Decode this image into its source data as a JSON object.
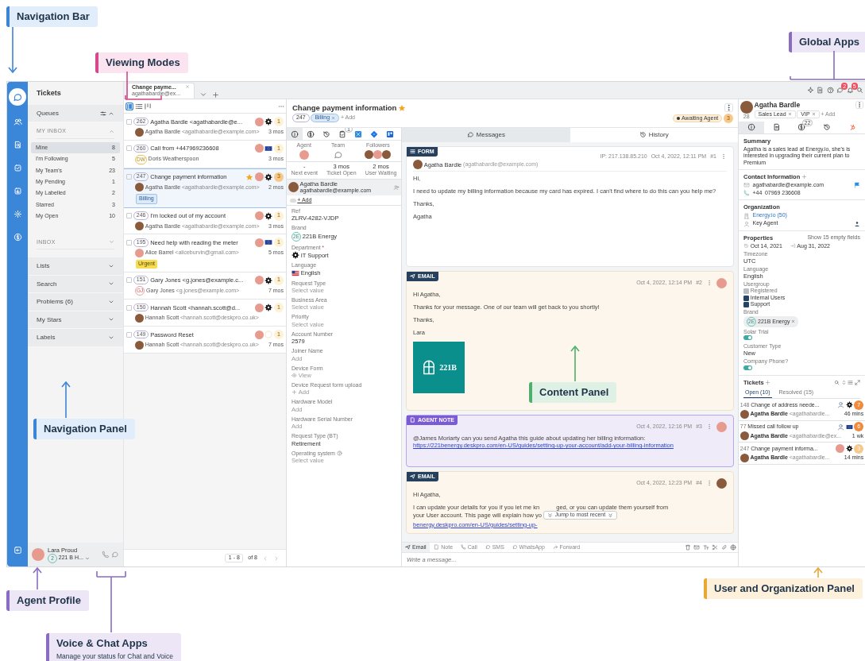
{
  "annotations": [
    {
      "title": "Navigation Bar",
      "color": "#3b84d8"
    },
    {
      "title": "Viewing Modes",
      "color": "#d6478c"
    },
    {
      "title": "Global Apps",
      "color": "#8a6cc2"
    },
    {
      "title": "Navigation Panel",
      "color": "#3b84d8"
    },
    {
      "title": "Content Panel",
      "color": "#4caf6a"
    },
    {
      "title": "Agent Profile",
      "color": "#8a6cc2"
    },
    {
      "title": "Voice & Chat Apps",
      "subtitle": "Manage your status for Chat and Voice",
      "color": "#8a6cc2"
    },
    {
      "title": "User and Organization Panel",
      "color": "#e8a835"
    }
  ],
  "rail": {
    "items": [
      {
        "selected": true
      },
      {
        "selected": false
      },
      {
        "selected": false
      },
      {
        "selected": false
      },
      {
        "selected": false
      },
      {
        "selected": false
      },
      {
        "selected": false
      }
    ]
  },
  "nav_panel": {
    "title": "Tickets",
    "queues": {
      "label": "Queues",
      "expanded": true
    },
    "my_inbox": {
      "label": "MY INBOX",
      "expanded": true,
      "items": [
        {
          "label": "Mine",
          "count": "8",
          "selected": true
        },
        {
          "label": "I'm Following",
          "count": "5",
          "selected": false
        },
        {
          "label": "My Team's",
          "count": "23",
          "selected": false
        },
        {
          "label": "My Pending",
          "count": "1",
          "selected": false
        },
        {
          "label": "My Labelled",
          "count": "2",
          "selected": false
        },
        {
          "label": "Starred",
          "count": "3",
          "selected": false
        },
        {
          "label": "My Open",
          "count": "10",
          "selected": false
        }
      ]
    },
    "inbox": {
      "label": "INBOX",
      "expanded": false
    },
    "sections": [
      {
        "label": "Lists",
        "expanded": false
      },
      {
        "label": "Search",
        "expanded": false
      },
      {
        "label": "Problems (6)",
        "expanded": false
      },
      {
        "label": "My Stars",
        "expanded": false
      },
      {
        "label": "Labels",
        "expanded": false
      }
    ],
    "agent": {
      "name": "Lara Proud",
      "badge": "2",
      "status": "221 B H..."
    }
  },
  "tab": {
    "title": "Change payme...",
    "subtitle": "agathabardle@ex..."
  },
  "global_apps": [
    {
      "kind": "sparkle"
    },
    {
      "kind": "doc"
    },
    {
      "kind": "help"
    },
    {
      "kind": "chat",
      "badge": "2"
    },
    {
      "kind": "bell",
      "badge": "5"
    },
    {
      "kind": "search"
    }
  ],
  "ticket_list": {
    "view_modes": [
      {
        "selected": true
      },
      {
        "selected": false
      },
      {
        "selected": false
      }
    ],
    "tickets": [
      {
        "id": "262",
        "subject": "Agatha Bardle <agathabardle@e...",
        "person": "Agatha Bardle",
        "email": "<agathabardle@example.com>",
        "age": "3 mos",
        "count": "1",
        "color": "#fdf1d6",
        "kind": "gear",
        "starred": false,
        "checked": false,
        "selected": false
      },
      {
        "id": "260",
        "subject": "Call from +447969236608",
        "person": "Doris Weatherspoon",
        "initials": "DW",
        "age": "3 mos",
        "count": "1",
        "color": "#fdf1d6",
        "kind": "flag",
        "starred": false,
        "checked": false,
        "selected": false
      },
      {
        "id": "247",
        "subject": "Change payment information",
        "person": "Agatha Bardle",
        "email": "<agathabardle@example.com>",
        "age": "2 mos",
        "count": "3",
        "color": "#f7c88a",
        "kind": "gear",
        "starred": true,
        "checked": false,
        "selected": true,
        "tag": {
          "label": "Billing",
          "kind": "info"
        }
      },
      {
        "id": "246",
        "subject": "I'm locked out of my account",
        "person": "Agatha Bardle",
        "email": "<agathabardle@example.com>",
        "age": "3 mos",
        "count": "1",
        "color": "#fdf1d6",
        "kind": "gear",
        "starred": false,
        "checked": false,
        "selected": false
      },
      {
        "id": "195",
        "subject": "Need help with reading the meter",
        "person": "Alice Barrel",
        "email": "<aliceburvin@gmail.com>",
        "age": "5 mos",
        "count": "1",
        "color": "#fdf1d6",
        "kind": "flag",
        "starred": false,
        "checked": false,
        "selected": false,
        "tag": {
          "label": "Urgent",
          "kind": "warning"
        }
      },
      {
        "id": "151",
        "subject": "Gary Jones <g.jones@example.c...",
        "person": "Gary Jones",
        "initials": "GJ",
        "email": "<g.jones@example.com>",
        "age": "7 mos",
        "count": "1",
        "color": "#fdf1d6",
        "kind": "gear",
        "starred": false,
        "checked": false,
        "selected": false
      },
      {
        "id": "150",
        "subject": "Hannah Scott <hannah.scott@d...",
        "person": "Hannah Scott",
        "email": "<hannah.scott@deskpro.co.uk>",
        "count": "1",
        "color": "#fdf1d6",
        "kind": "gear",
        "starred": false,
        "checked": false,
        "selected": false
      },
      {
        "id": "149",
        "subject": "Password Reset",
        "person": "Hannah Scott",
        "email": "<hannah.scott@deskpro.co.uk>",
        "age": "7 mos",
        "count": "1",
        "color": "#fdf1d6",
        "kind": "faded",
        "starred": false,
        "checked": false,
        "selected": false
      }
    ],
    "pagination": {
      "range": "1 - 8",
      "total": "of 8"
    }
  },
  "ticket": {
    "title": "Change payment information",
    "starred": true,
    "id": "247",
    "tags": [
      "Billing"
    ],
    "add": "+ Add",
    "status": "Awaiting Agent",
    "status_count": "3",
    "tabs": [
      {
        "selected": true
      },
      {
        "selected": false
      },
      {
        "selected": false
      },
      {
        "badge": "1",
        "selected": false
      },
      {
        "selected": false
      },
      {
        "selected": false
      },
      {
        "selected": false
      }
    ],
    "people": [
      {
        "label": "Agent",
        "kind": "agent"
      },
      {
        "label": "Team",
        "kind": "team"
      },
      {
        "label": "Followers",
        "kind": "followers"
      }
    ],
    "stats": [
      {
        "value": "-",
        "label": "Next event"
      },
      {
        "value": "3 mos",
        "label": "Ticket Open"
      },
      {
        "value": "2 mos",
        "label": "User Waiting"
      }
    ],
    "user": {
      "name": "Agatha Bardle",
      "email": "agathabardle@example.com"
    },
    "cc_add": "+ Add",
    "fields": [
      {
        "label": "Ref",
        "value": "ZLRV-4282-VJDP",
        "kind": "text"
      },
      {
        "label": "Brand",
        "value": "221B Energy",
        "kind": "brand",
        "badge": "2E"
      },
      {
        "label": "Department",
        "marker": "*",
        "value": "IT Support",
        "kind": "dept"
      },
      {
        "label": "Language",
        "value": "English",
        "kind": "lang"
      },
      {
        "label": "Request Type",
        "placeholder": "Select value",
        "kind": "empty"
      },
      {
        "label": "Business Area",
        "placeholder": "Select value",
        "kind": "empty"
      },
      {
        "label": "Priority",
        "placeholder": "Select value",
        "kind": "empty"
      },
      {
        "label": "Account Number",
        "value": "2579",
        "kind": "text"
      },
      {
        "label": "Joiner Name",
        "placeholder": "Add",
        "kind": "empty"
      },
      {
        "label": "Device Form",
        "value": "View",
        "kind": "view"
      },
      {
        "label": "Device Request form upload",
        "value": "Add",
        "kind": "add"
      },
      {
        "label": "Hardware Model",
        "placeholder": "Add",
        "kind": "empty"
      },
      {
        "label": "Hardware Serial Number",
        "placeholder": "Add",
        "kind": "empty"
      },
      {
        "label": "Request Type (BT)",
        "value": "Retirement",
        "kind": "text"
      },
      {
        "label": "Operating system",
        "placeholder": "Select value",
        "kind": "empty",
        "help": true
      }
    ]
  },
  "content": {
    "tabs": [
      {
        "label": "Messages",
        "selected": true
      },
      {
        "label": "History",
        "selected": false
      }
    ],
    "messages": [
      {
        "kind": "form",
        "label": "FORM",
        "meta": [
          "IP: 217.138.85.210",
          "Oct 4, 2022, 12:11 PM",
          "#1"
        ],
        "author": "Agatha Bardle",
        "author_email": "(agathabardle@example.com)",
        "paragraphs": [
          "Hi,",
          "I need to update my billing information because my card has expired. I can't find where to do this can you help me?",
          "Thanks,",
          "Agatha"
        ]
      },
      {
        "kind": "email",
        "label": "EMAIL",
        "meta": [
          "Oct 4, 2022, 12:14 PM",
          "#2"
        ],
        "paragraphs": [
          "Hi Agatha,",
          "Thanks for your message. One of our team will get back to you shortly!",
          "Thanks,",
          "Lara"
        ],
        "logo": "221B"
      },
      {
        "kind": "note",
        "label": "AGENT NOTE",
        "meta": [
          "Oct 4, 2022, 12:16 PM",
          "#3"
        ],
        "paragraphs": [
          "@James Moriarty can you send Agatha this guide about updating her billing information:"
        ],
        "link": "https://221benergy.deskpro.com/en-US/guides/setting-up-your-account/add-your-billing-information"
      },
      {
        "kind": "email",
        "label": "EMAIL",
        "meta": [
          "Oct 4, 2022, 12:23 PM",
          "#4"
        ],
        "paragraphs": [
          "Hi Agatha,"
        ],
        "partial": {
          "line_1_start": "I can update your details for you if you let me kn",
          "line_1_end": "ged, or you can update them yourself from",
          "line_2_start": "your User account. This page will explain how yo",
          "line_2_link": "benergy.deskpro.com/en-US/guides/setting-up-"
        }
      }
    ],
    "jump": "Jump to most recent",
    "composer": {
      "actions": [
        {
          "label": "Email",
          "selected": true
        },
        {
          "label": "Note",
          "selected": false
        },
        {
          "label": "Call",
          "selected": false
        },
        {
          "label": "SMS",
          "selected": false
        },
        {
          "label": "WhatsApp",
          "selected": false
        },
        {
          "label": "Forward",
          "selected": false
        }
      ],
      "placeholder": "Write a message..."
    }
  },
  "user_panel": {
    "name": "Agatha Bardle",
    "avatar_number": "28",
    "tags": [
      "Sales Lead",
      "VIP"
    ],
    "add": "+ Add",
    "tabs": [
      {
        "selected": true
      },
      {
        "selected": false
      },
      {
        "badge": "22",
        "selected": false
      },
      {
        "selected": false
      },
      {
        "selected": false
      }
    ],
    "summary": {
      "title": "Summary",
      "text": "Agatha is a sales lead at Energy.io, she's is interested in upgrading their current plan to Premium"
    },
    "contact": {
      "title": "Contact Information",
      "email": "agathabardle@example.com",
      "phone_code": "+44",
      "phone": "07969 236608"
    },
    "organization": {
      "title": "Organization",
      "name": "Energy.io (50)",
      "role": "Key Agent"
    },
    "properties": {
      "title": "Properties",
      "show_empty": "Show 15 empty fields",
      "date_start": "Oct 14, 2021",
      "date_end": "Aug 31, 2022",
      "fields": [
        {
          "label": "Timezone",
          "kind": "text",
          "value": "UTC"
        },
        {
          "label": "Language",
          "kind": "text",
          "value": "English"
        },
        {
          "label": "Usergroup",
          "kind": "checks",
          "options": [
            {
              "label": "Registered",
              "checked": true,
              "disabled": true
            },
            {
              "label": "Internal Users",
              "checked": true,
              "disabled": false
            },
            {
              "label": "Support",
              "checked": true,
              "disabled": false
            }
          ]
        },
        {
          "label": "Brand",
          "kind": "chip",
          "value": "221B Energy",
          "badge": "2E"
        },
        {
          "label": "Solar Trial",
          "kind": "toggle",
          "on": true
        },
        {
          "label": "Customer Type",
          "kind": "text",
          "value": "New"
        },
        {
          "label": "Company Phone?",
          "kind": "toggle",
          "on": true
        }
      ]
    },
    "tickets": {
      "title": "Tickets",
      "tabs": [
        {
          "label": "Open (10)",
          "selected": true
        },
        {
          "label": "Resolved (15)",
          "selected": false
        }
      ],
      "rows": [
        {
          "id": "148",
          "subject": "Change of address neede...",
          "person": "Agatha Bardle",
          "email": "<agathabardle...",
          "age": "46 mins",
          "count": "7",
          "color": "#f08a3c",
          "assigned": false,
          "kind": "gear"
        },
        {
          "id": "77",
          "subject": "Missed call follow up",
          "person": "Agatha Bardle",
          "email": "<agathabardle@ex...",
          "age": "1 wk",
          "count": "6",
          "color": "#f08a3c",
          "assigned": false,
          "kind": "flag"
        },
        {
          "id": "247",
          "subject": "Change payment informa...",
          "person": "Agatha Bardle",
          "email": "<agathabardle...",
          "age": "14 mins",
          "count": "3",
          "color": "#f7c88a",
          "assigned": true,
          "kind": "gear"
        }
      ]
    }
  }
}
